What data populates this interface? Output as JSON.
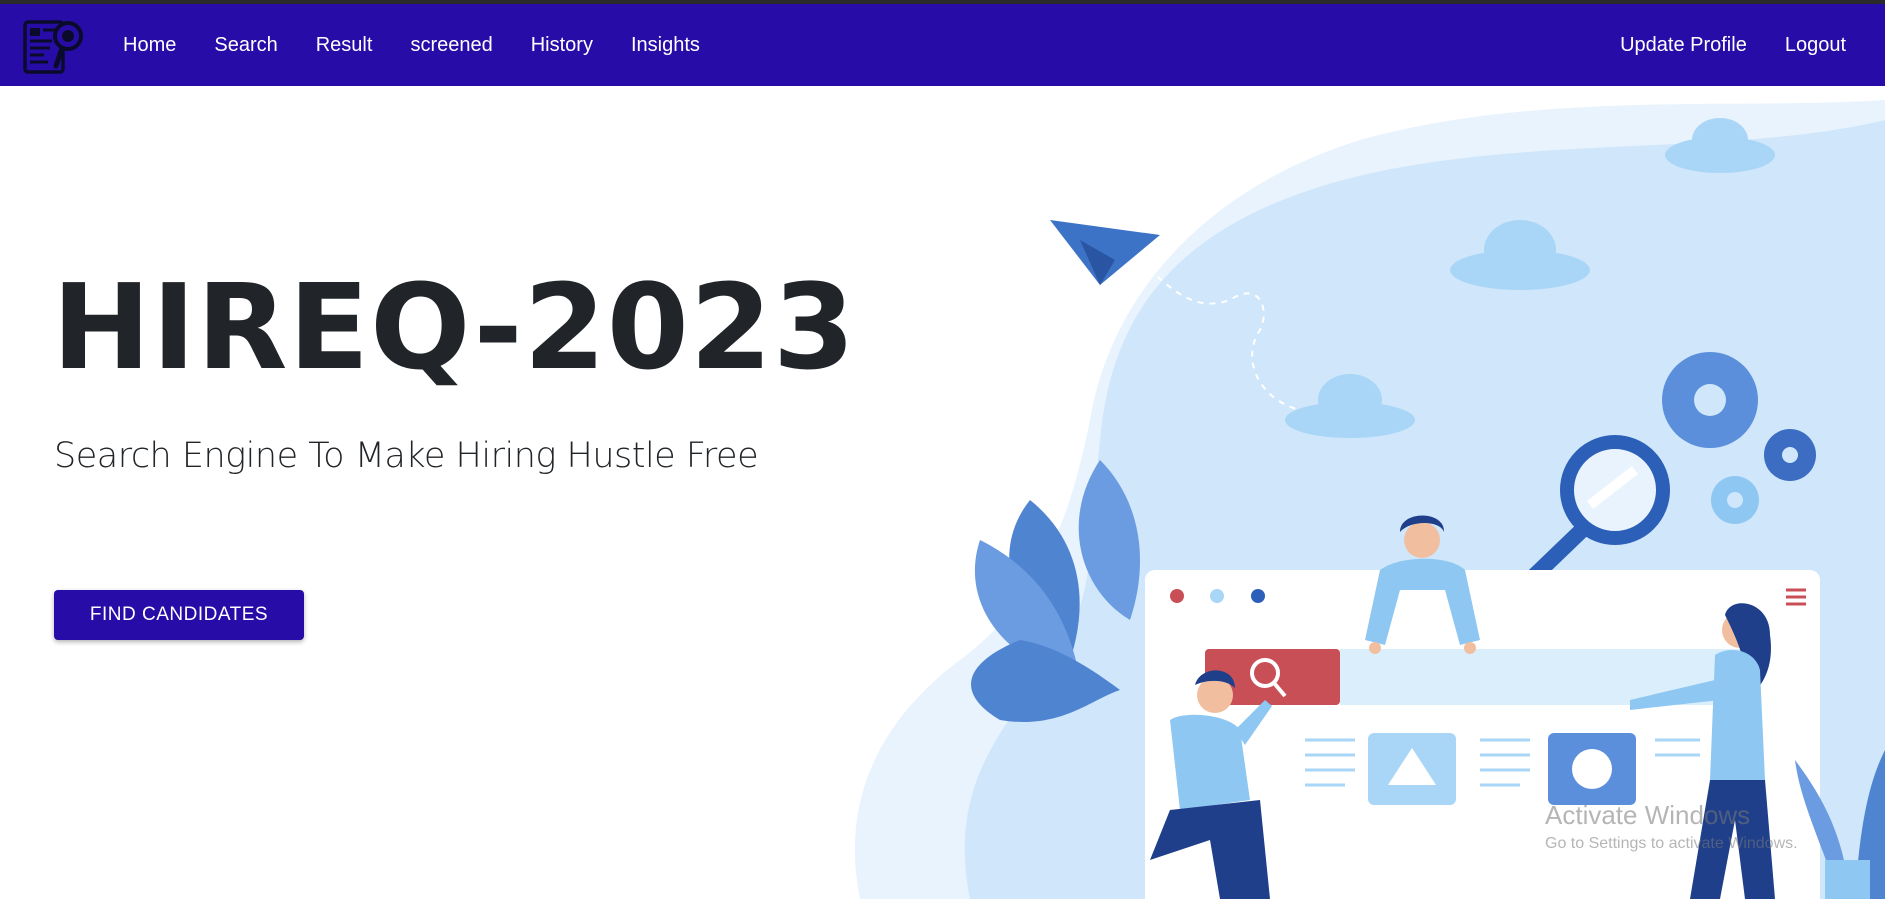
{
  "nav": {
    "logo_icon": "resume-search-icon",
    "links": [
      "Home",
      "Search",
      "Result",
      "screened",
      "History",
      "Insights"
    ],
    "right_links": [
      "Update Profile",
      "Logout"
    ],
    "bg_color": "#280ca7"
  },
  "hero": {
    "title": "HIREQ-2023",
    "subtitle": "Search Engine To Make Hiring Hustle Free",
    "cta_label": "FIND CANDIDATES"
  },
  "illustration": {
    "icon": "recruitment-search-illustration",
    "accent_red": "#c94f57",
    "accent_blue": "#2c5fb8"
  },
  "watermark": {
    "title": "Activate Windows",
    "subtitle": "Go to Settings to activate Windows."
  }
}
